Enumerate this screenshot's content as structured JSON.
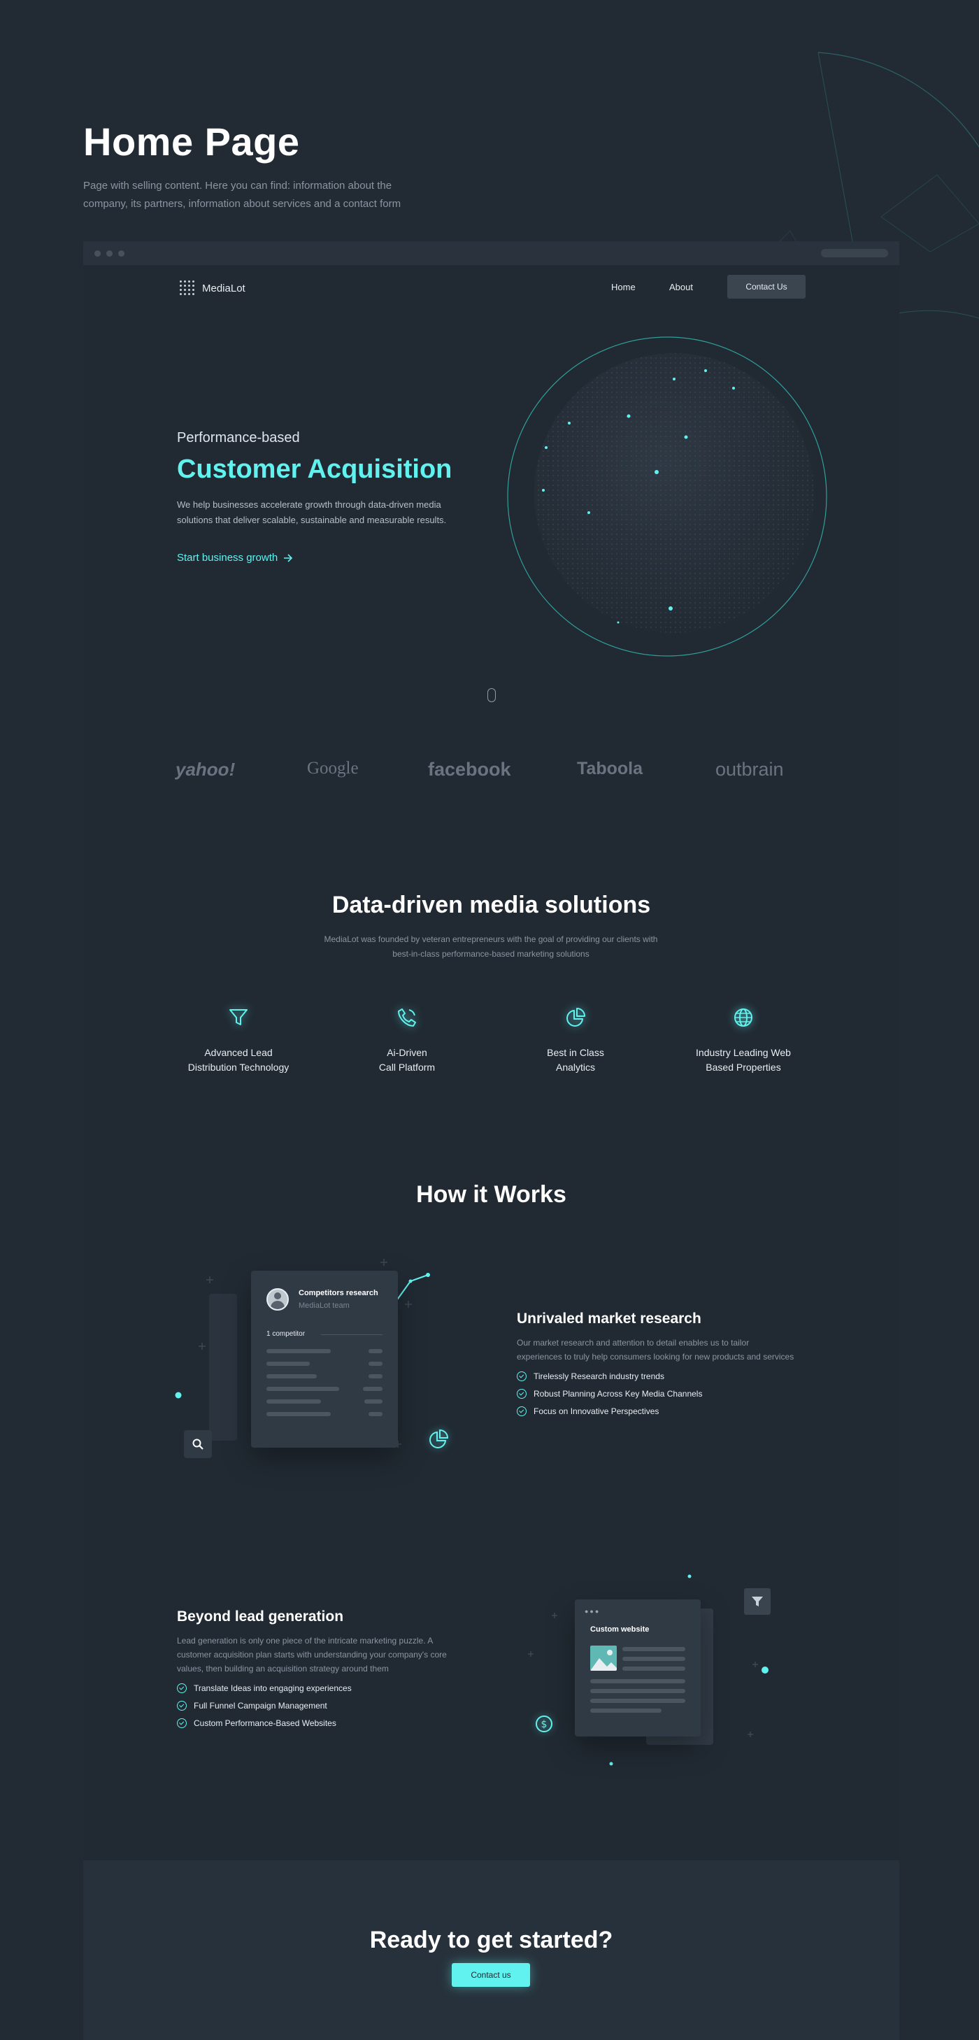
{
  "intro": {
    "title": "Home Page",
    "description": "Page with selling content. Here you can find: information about the company, its partners, information about services and a contact form"
  },
  "nav": {
    "logo_text": "MediaLot",
    "home": "Home",
    "about": "About",
    "contact": "Contact Us"
  },
  "hero": {
    "eyebrow": "Performance-based",
    "title": "Customer Acquisition",
    "description": "We help businesses accelerate growth through data-driven media solutions that deliver scalable, sustainable and measurable results.",
    "cta": "Start business growth"
  },
  "partners": [
    "yahoo!",
    "Google",
    "facebook",
    "Taboola",
    "outbrain"
  ],
  "solutions": {
    "title": "Data-driven media solutions",
    "subtitle": "MediaLot was founded by veteran entrepreneurs with the goal of providing our clients with best-in-class performance-based marketing solutions",
    "features": [
      {
        "icon": "funnel-icon",
        "line1": "Advanced Lead",
        "line2": "Distribution Technology"
      },
      {
        "icon": "phone-icon",
        "line1": "Ai-Driven",
        "line2": "Call Platform"
      },
      {
        "icon": "pie-chart-icon",
        "line1": "Best in Class",
        "line2": "Analytics"
      },
      {
        "icon": "globe-icon",
        "line1": "Industry Leading Web",
        "line2": "Based Properties"
      }
    ]
  },
  "how": {
    "title": "How it Works",
    "card1": {
      "title": "Competitors research",
      "subtitle": "MediaLot team",
      "label": "1 competitor"
    },
    "block1": {
      "title": "Unrivaled market research",
      "description": "Our market research and attention to detail enables us to tailor experiences to truly help consumers looking for new products and services",
      "items": [
        "Tirelessly Research industry trends",
        "Robust Planning Across Key Media Channels",
        "Focus on Innovative Perspectives"
      ]
    },
    "card2": {
      "title": "Custom website"
    },
    "block2": {
      "title": "Beyond lead generation",
      "description": "Lead generation is only one piece of the intricate marketing puzzle. A customer acquisition plan starts with understanding your company's core values, then building an acquisition strategy around them",
      "items": [
        "Translate Ideas into engaging experiences",
        "Full Funnel Campaign Management",
        "Custom Performance-Based Websites"
      ]
    }
  },
  "cta": {
    "title": "Ready to get started?",
    "button": "Contact us"
  },
  "colors": {
    "accent": "#61f1ee",
    "background": "#222b34",
    "panel": "#303a45"
  }
}
